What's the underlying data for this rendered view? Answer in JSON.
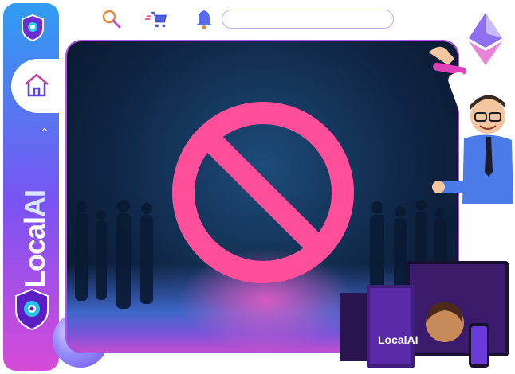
{
  "sidebar": {
    "brand_local": "Local",
    "brand_ai": "AI"
  },
  "topbar": {
    "search_placeholder": ""
  },
  "icons": {
    "search": "search-icon",
    "cart": "cart-icon",
    "bell": "bell-icon",
    "home": "home-icon",
    "chevron": "chevron-up-icon"
  },
  "product": {
    "box_label": "LocalAI"
  },
  "colors": {
    "sidebar_top": "#2f9df1",
    "sidebar_bottom": "#d64bd8",
    "accent_pink": "#ff4f9a",
    "hero_bg": "#0f2545"
  }
}
